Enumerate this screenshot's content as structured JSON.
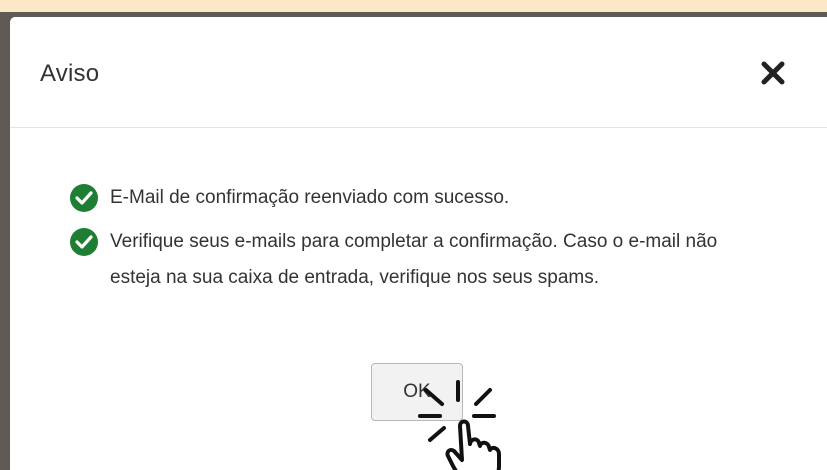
{
  "dialog": {
    "title": "Aviso",
    "messages": [
      "E-Mail de confirmação reenviado com sucesso.",
      "Verifique seus e-mails para completar a confirmação. Caso o e-mail não esteja na sua caixa de entrada, verifique nos seus spams."
    ],
    "ok_label": "OK"
  },
  "icons": {
    "close": "close-icon",
    "success": "check-circle-icon",
    "cursor": "pointer-hand-click-icon"
  },
  "colors": {
    "page_background": "#fce8c6",
    "backdrop": "#5f5a56",
    "success_green": "#1e7e34",
    "text": "#333333"
  }
}
